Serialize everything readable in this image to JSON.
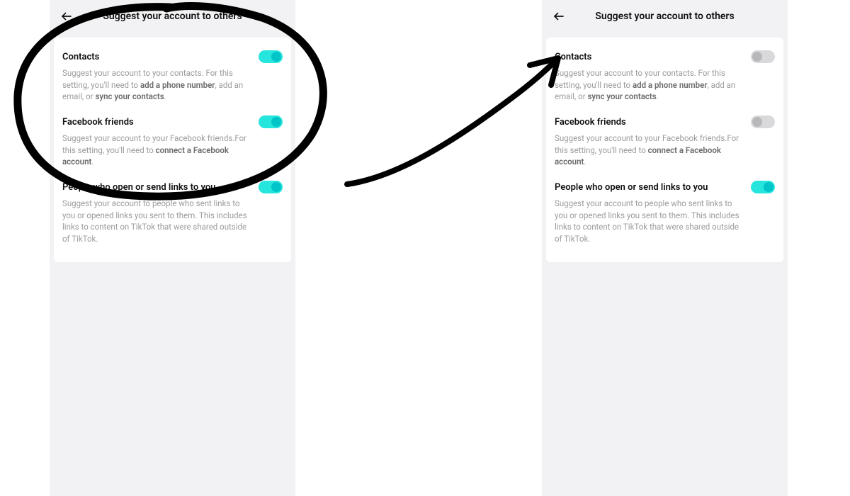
{
  "left": {
    "header": {
      "title": "Suggest your account to others"
    },
    "settings": [
      {
        "title": "Contacts",
        "desc_pre": "Suggest your account to your contacts. For this setting, you'll need to ",
        "link1": "add a phone number",
        "mid1": ", add an email, or ",
        "link2": "sync your contacts",
        "tail": ".",
        "on": true
      },
      {
        "title": "Facebook friends",
        "desc_pre": "Suggest your account to your Facebook friends.For this setting, you'll need to ",
        "link1": "connect a Facebook account",
        "mid1": "",
        "link2": "",
        "tail": ".",
        "on": true
      },
      {
        "title": "People who open or send links to you",
        "desc_pre": "Suggest your account to people who sent links to you or opened links you sent to them. This includes links to content on TikTok that were shared outside of TikTok.",
        "link1": "",
        "mid1": "",
        "link2": "",
        "tail": "",
        "on": true
      }
    ]
  },
  "right": {
    "header": {
      "title": "Suggest your account to others"
    },
    "settings": [
      {
        "title": "Contacts",
        "desc_pre": "Suggest your account to your contacts. For this setting, you'll need to ",
        "link1": "add a phone number",
        "mid1": ", add an email, or ",
        "link2": "sync your contacts",
        "tail": ".",
        "on": false
      },
      {
        "title": "Facebook friends",
        "desc_pre": "Suggest your account to your Facebook friends.For this setting, you'll need to ",
        "link1": "connect a Facebook account",
        "mid1": "",
        "link2": "",
        "tail": ".",
        "on": false
      },
      {
        "title": "People who open or send links to you",
        "desc_pre": "Suggest your account to people who sent links to you or opened links you sent to them. This includes links to content on TikTok that were shared outside of TikTok.",
        "link1": "",
        "mid1": "",
        "link2": "",
        "tail": "",
        "on": true
      }
    ]
  }
}
